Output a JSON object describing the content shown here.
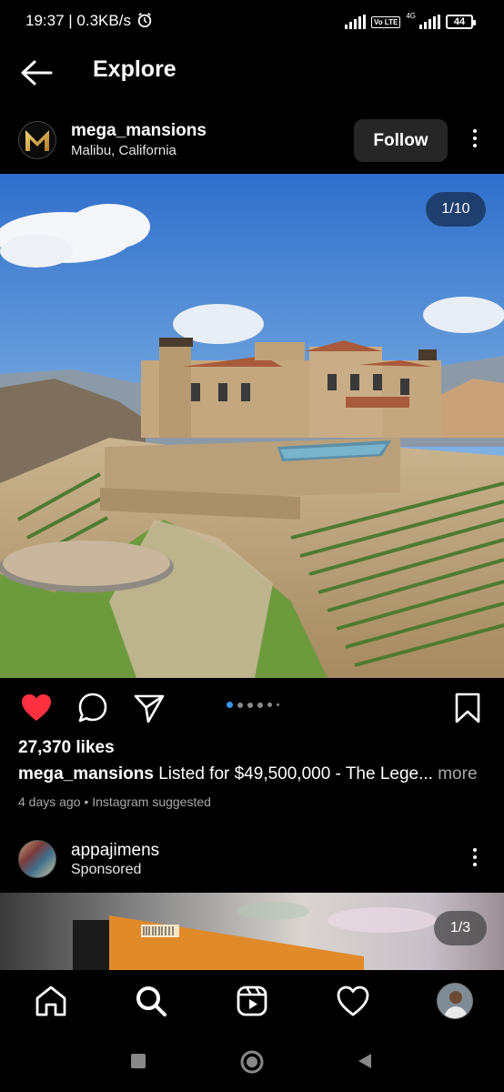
{
  "status_bar": {
    "time": "19:37",
    "speed": "0.3KB/s",
    "volte": "Vo LTE",
    "net": "4G",
    "battery": "44"
  },
  "header": {
    "title": "Explore"
  },
  "post": {
    "username": "mega_mansions",
    "location": "Malibu, California",
    "follow_label": "Follow",
    "image_counter": "1/10",
    "likes": "27,370 likes",
    "caption_user": "mega_mansions",
    "caption_text": "Listed for $49,500,000 - The Lege...",
    "caption_more": "more",
    "time_ago": "4 days ago",
    "separator": "•",
    "suggested": "Instagram suggested",
    "liked": true,
    "carousel_active_index": 0
  },
  "sponsored_post": {
    "username": "appajimens",
    "label": "Sponsored",
    "image_counter": "1/3"
  },
  "bottom_nav": {
    "items": [
      "home-icon",
      "search-icon",
      "reels-icon",
      "heart-icon",
      "profile-avatar"
    ]
  },
  "colors": {
    "like_red": "#ff3040",
    "background": "#000000",
    "button_gray": "#262626"
  }
}
